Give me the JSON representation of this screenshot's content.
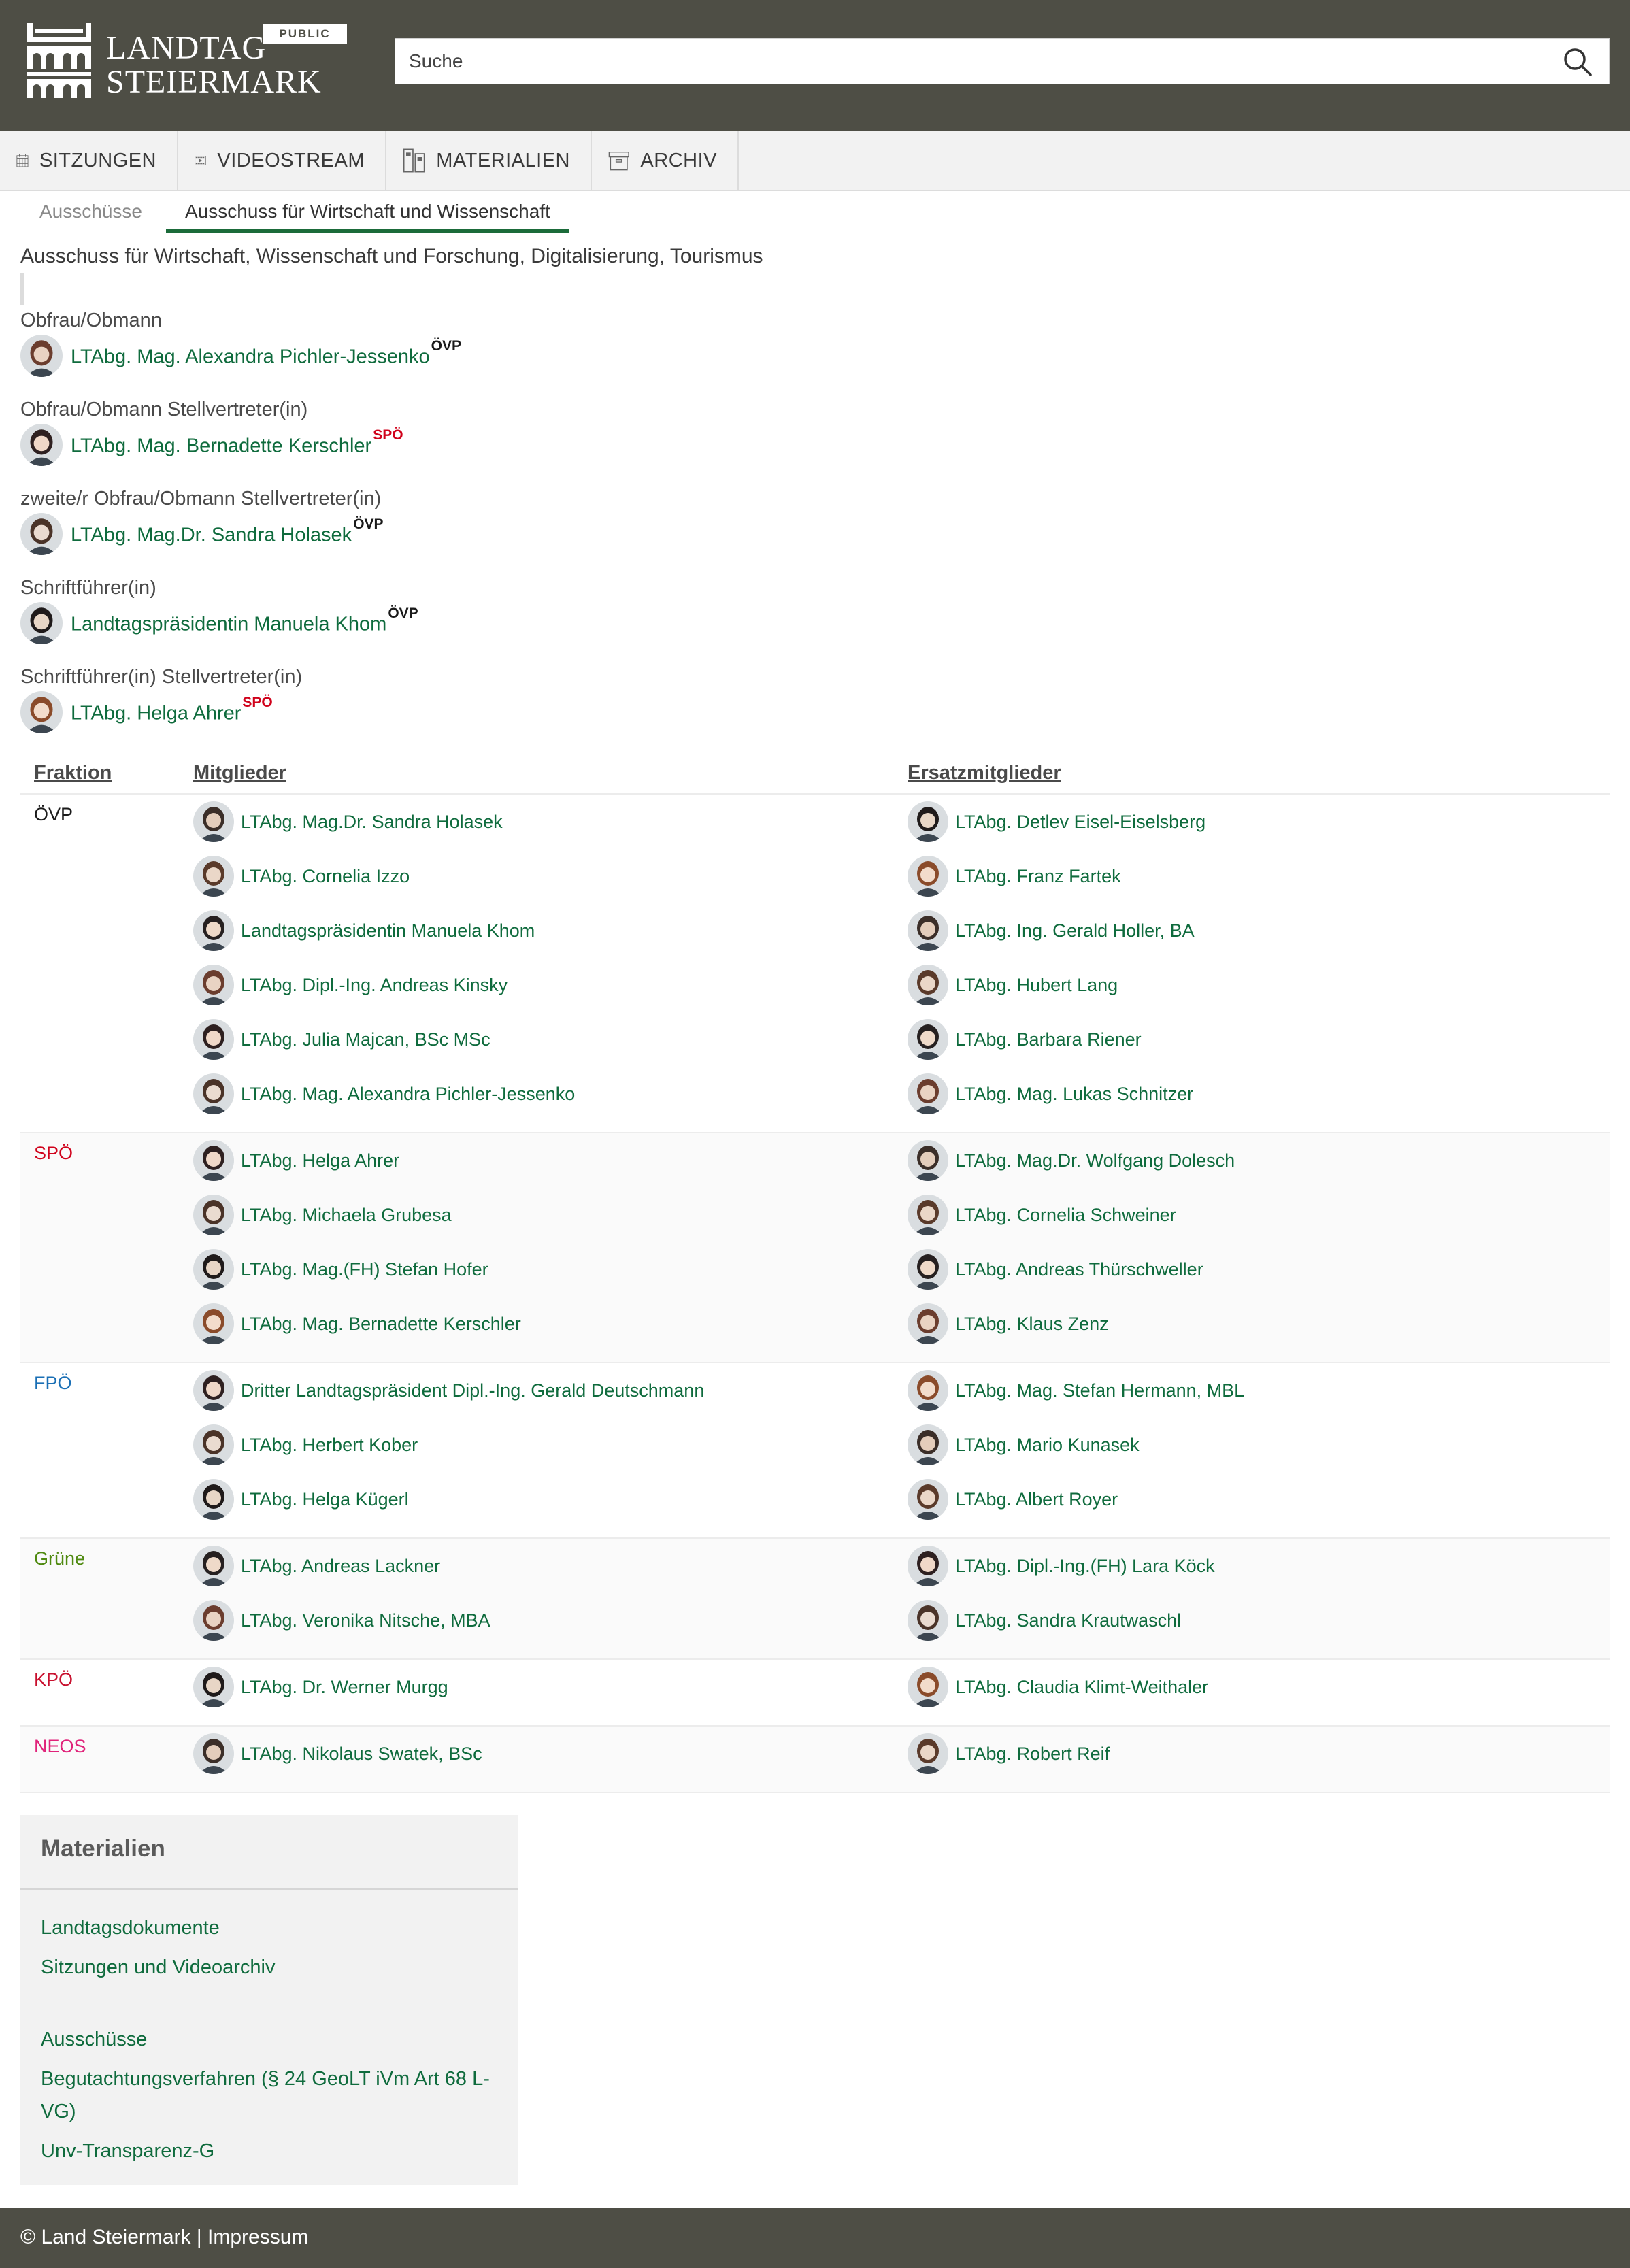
{
  "header": {
    "logo_line1": "LANDTAG",
    "logo_line2": "STEIERMARK",
    "badge": "PUBLIC",
    "search_placeholder": "Suche"
  },
  "nav": [
    {
      "label": "SITZUNGEN",
      "icon": "calendar-icon"
    },
    {
      "label": "VIDEOSTREAM",
      "icon": "video-icon"
    },
    {
      "label": "MATERIALIEN",
      "icon": "binders-icon"
    },
    {
      "label": "ARCHIV",
      "icon": "archive-box-icon"
    }
  ],
  "subtabs": {
    "parent": "Ausschüsse",
    "current": "Ausschuss für Wirtschaft und Wissenschaft"
  },
  "committee_title": "Ausschuss für Wirtschaft, Wissenschaft und Forschung, Digitalisierung, Tourismus",
  "officers": [
    {
      "role": "Obfrau/Obmann",
      "name": "LTAbg. Mag. Alexandra Pichler-Jessenko",
      "party": "ÖVP"
    },
    {
      "role": "Obfrau/Obmann Stellvertreter(in)",
      "name": "LTAbg. Mag. Bernadette Kerschler",
      "party": "SPÖ"
    },
    {
      "role": "zweite/r Obfrau/Obmann Stellvertreter(in)",
      "name": "LTAbg. Mag.Dr. Sandra Holasek",
      "party": "ÖVP"
    },
    {
      "role": "Schriftführer(in)",
      "name": "Landtagspräsidentin Manuela Khom",
      "party": "ÖVP"
    },
    {
      "role": "Schriftführer(in) Stellvertreter(in)",
      "name": "LTAbg. Helga Ahrer",
      "party": "SPÖ"
    }
  ],
  "table": {
    "headers": {
      "fraktion": "Fraktion",
      "mitglieder": "Mitglieder",
      "ersatz": "Ersatzmitglieder"
    },
    "groups": [
      {
        "party": "ÖVP",
        "members": [
          "LTAbg. Mag.Dr. Sandra Holasek",
          "LTAbg. Cornelia Izzo",
          "Landtagspräsidentin Manuela Khom",
          "LTAbg. Dipl.-Ing. Andreas Kinsky",
          "LTAbg. Julia Majcan, BSc MSc",
          "LTAbg. Mag. Alexandra Pichler-Jessenko"
        ],
        "substitutes": [
          "LTAbg. Detlev Eisel-Eiselsberg",
          "LTAbg. Franz Fartek",
          "LTAbg. Ing. Gerald Holler, BA",
          "LTAbg. Hubert Lang",
          "LTAbg. Barbara Riener",
          "LTAbg. Mag. Lukas Schnitzer"
        ]
      },
      {
        "party": "SPÖ",
        "members": [
          "LTAbg. Helga Ahrer",
          "LTAbg. Michaela Grubesa",
          "LTAbg. Mag.(FH) Stefan Hofer",
          "LTAbg. Mag. Bernadette Kerschler"
        ],
        "substitutes": [
          "LTAbg. Mag.Dr. Wolfgang Dolesch",
          "LTAbg. Cornelia Schweiner",
          "LTAbg. Andreas Thürschweller",
          "LTAbg. Klaus Zenz"
        ]
      },
      {
        "party": "FPÖ",
        "members": [
          "Dritter Landtagspräsident Dipl.-Ing. Gerald Deutschmann",
          "LTAbg. Herbert Kober",
          "LTAbg. Helga Kügerl"
        ],
        "substitutes": [
          "LTAbg. Mag. Stefan Hermann, MBL",
          "LTAbg. Mario Kunasek",
          "LTAbg. Albert Royer"
        ]
      },
      {
        "party": "Grüne",
        "members": [
          "LTAbg. Andreas Lackner",
          "LTAbg. Veronika Nitsche, MBA"
        ],
        "substitutes": [
          "LTAbg. Dipl.-Ing.(FH) Lara Köck",
          "LTAbg. Sandra Krautwaschl"
        ]
      },
      {
        "party": "KPÖ",
        "members": [
          "LTAbg. Dr. Werner Murgg"
        ],
        "substitutes": [
          "LTAbg. Claudia Klimt-Weithaler"
        ]
      },
      {
        "party": "NEOS",
        "members": [
          "LTAbg. Nikolaus Swatek, BSc"
        ],
        "substitutes": [
          "LTAbg. Robert Reif"
        ]
      }
    ]
  },
  "party_colors": {
    "ÖVP": "#1a1a1a",
    "SPÖ": "#d0021b",
    "FPÖ": "#1a6fb5",
    "Grüne": "#4f8a10",
    "KPÖ": "#c8102e",
    "NEOS": "#e0237a"
  },
  "materialien": {
    "title": "Materialien",
    "links": [
      "Landtagsdokumente",
      "Sitzungen und Videoarchiv",
      "Ausschüsse",
      "Begutachtungsverfahren (§ 24 GeoLT iVm Art 68 L-VG)",
      "Unv-Transparenz-G"
    ]
  },
  "footer": {
    "copyright": "© Land Steiermark",
    "separator": "|",
    "impressum": "Impressum"
  }
}
